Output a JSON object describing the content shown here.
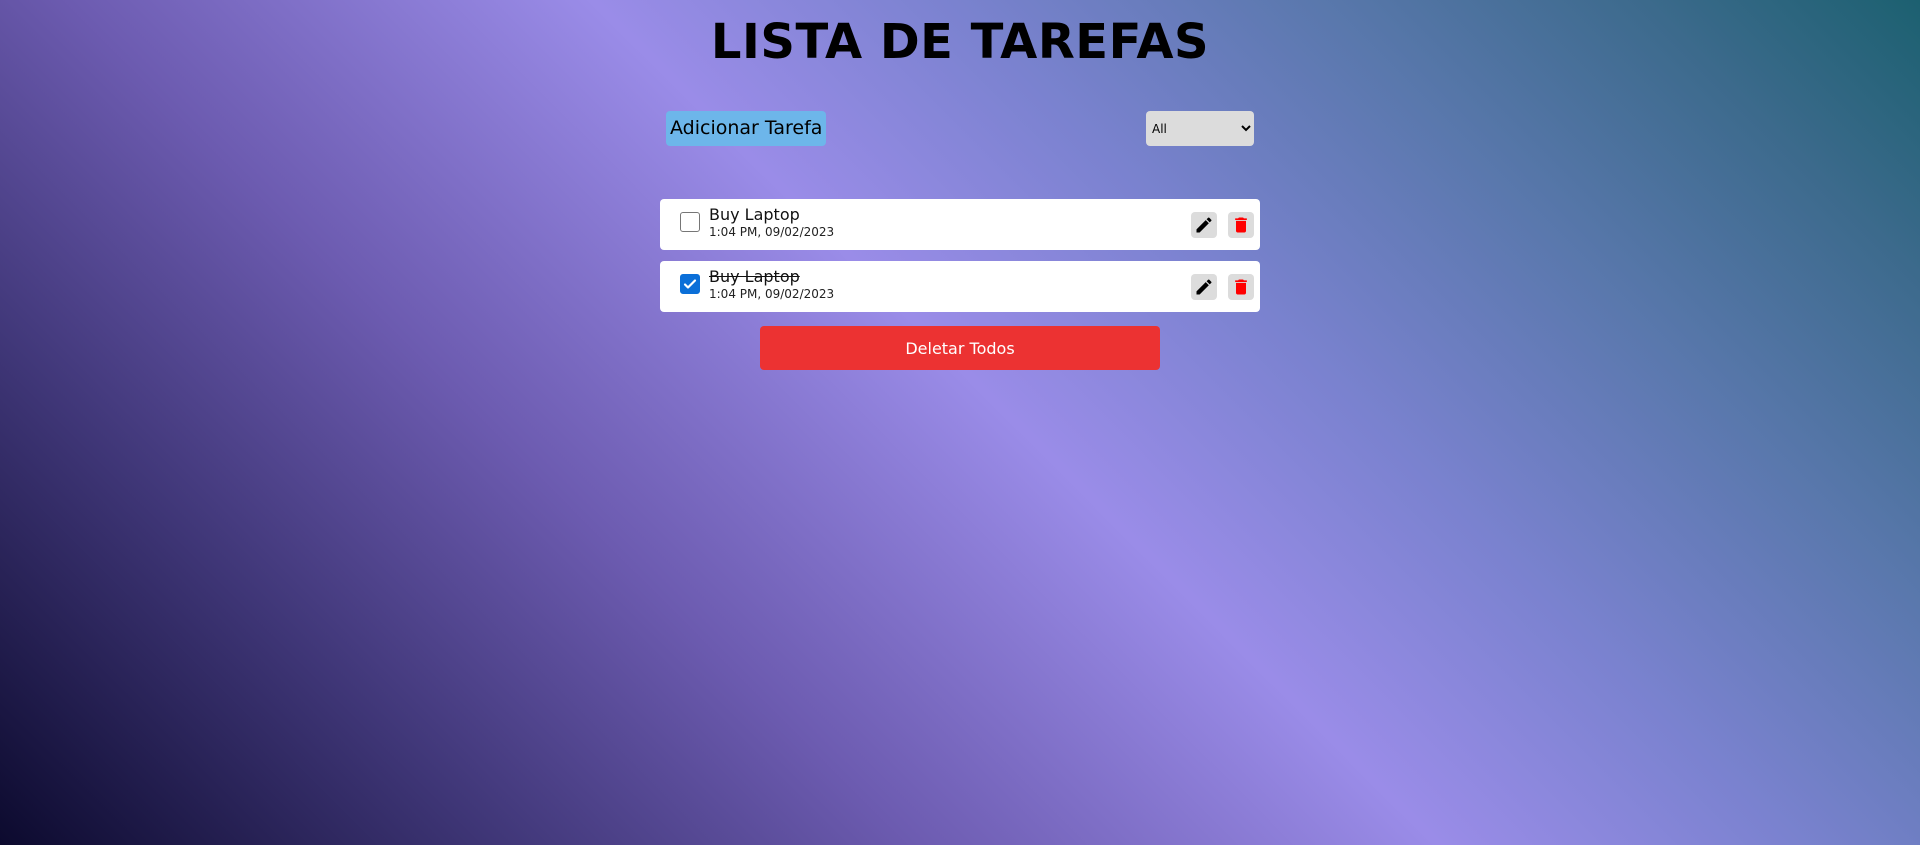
{
  "header": {
    "title": "LISTA DE TAREFAS"
  },
  "toolbar": {
    "add_label": "Adicionar Tarefa",
    "filter": {
      "selected": "All",
      "options": [
        "All"
      ]
    }
  },
  "todos": [
    {
      "title": "Buy Laptop",
      "time": "1:04 PM, 09/02/2023",
      "completed": false
    },
    {
      "title": "Buy Laptop",
      "time": "1:04 PM, 09/02/2023",
      "completed": true
    }
  ],
  "actions": {
    "delete_all_label": "Deletar Todos"
  },
  "icons": {
    "edit": "pencil-icon",
    "delete": "trash-icon"
  },
  "colors": {
    "add_button": "#6db6ea",
    "delete_all": "#ec3232",
    "trash_icon": "#ff0000",
    "checkbox_checked": "#0b6fd8"
  }
}
